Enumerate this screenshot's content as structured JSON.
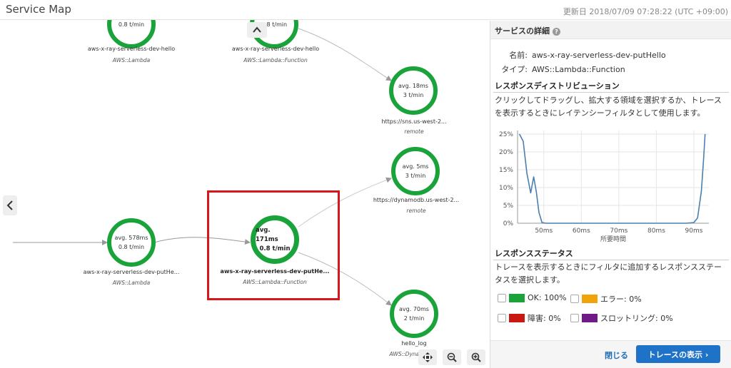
{
  "header": {
    "title": "Service Map",
    "updated": "更新日 2018/07/09 07:28:22 (UTC +09:00)"
  },
  "map": {
    "nodes": [
      {
        "id": "hello",
        "line1": "",
        "line2": "0.8 t/min",
        "name": "aws-x-ray-serverless-dev-hello",
        "type": "AWS::Lambda"
      },
      {
        "id": "hello-fn",
        "line1": "",
        "line2": "0.8 t/min",
        "name": "aws-x-ray-serverless-dev-hello",
        "type": "AWS::Lambda::Function"
      },
      {
        "id": "sns",
        "line1": "avg. 18ms",
        "line2": "3 t/min",
        "name": "https://sns.us-west-2...",
        "type": "remote"
      },
      {
        "id": "dynamodb",
        "line1": "avg. 5ms",
        "line2": "3 t/min",
        "name": "https://dynamodb.us-west-2...",
        "type": "remote"
      },
      {
        "id": "puthello",
        "line1": "avg. 578ms",
        "line2": "0.8 t/min",
        "name": "aws-x-ray-serverless-dev-putHe...",
        "type": "AWS::Lambda"
      },
      {
        "id": "puthello-fn",
        "line1": "avg. 171ms",
        "line2": "0.8 t/min",
        "name": "aws-x-ray-serverless-dev-putHe...",
        "type": "AWS::Lambda::Function"
      },
      {
        "id": "hellolog",
        "line1": "avg. 70ms",
        "line2": "2 t/min",
        "name": "hello_log",
        "type": "AWS::Dynam"
      }
    ],
    "collapse_icon": "chevron-up-icon",
    "side_icon": "chevron-left-icon"
  },
  "panel": {
    "title": "サービスの詳細",
    "name_label": "名前:",
    "name_value": "aws-x-ray-serverless-dev-putHello",
    "type_label": "タイプ:",
    "type_value": "AWS::Lambda::Function",
    "dist_title": "レスポンスディストリビューション",
    "dist_desc": "クリックしてドラッグし、拡大する領域を選択するか、トレースを表示するときにレイテンシーフィルタとして使用します。",
    "status_title": "レスポンスステータス",
    "status_desc": "トレースを表示するときにフィルタに追加するレスポンスステータスを選択します。",
    "statuses": [
      {
        "label": "OK: 100%",
        "color": "#1aa33a"
      },
      {
        "label": "エラー: 0%",
        "color": "#f0a30a"
      },
      {
        "label": "障害: 0%",
        "color": "#c8180f"
      },
      {
        "label": "スロットリング: 0%",
        "color": "#6f1a86"
      }
    ],
    "close_label": "閉じる",
    "traces_label": "トレースの表示 ›"
  },
  "chart_data": {
    "type": "line",
    "xlabel": "所要時間",
    "ylabel": "",
    "x_ticks": [
      "50ms",
      "60ms",
      "70ms",
      "80ms",
      "90ms"
    ],
    "y_ticks": [
      "0%",
      "5%",
      "10%",
      "15%",
      "20%",
      "25%"
    ],
    "xlim": [
      43,
      94
    ],
    "ylim": [
      0,
      26
    ],
    "series": [
      {
        "x": [
          43.5,
          44.5,
          45.5,
          46.5,
          47.3,
          48.0,
          48.7,
          49.5,
          50.5,
          52,
          55,
          60,
          70,
          80,
          88,
          90,
          91,
          92,
          92.6,
          93.0
        ],
        "y": [
          25,
          23,
          14,
          8.5,
          13,
          8.8,
          3,
          0.2,
          0,
          0,
          0,
          0,
          0,
          0,
          0,
          0.2,
          1.5,
          9,
          18,
          25
        ]
      }
    ],
    "line_color": "#4a7fb0"
  }
}
